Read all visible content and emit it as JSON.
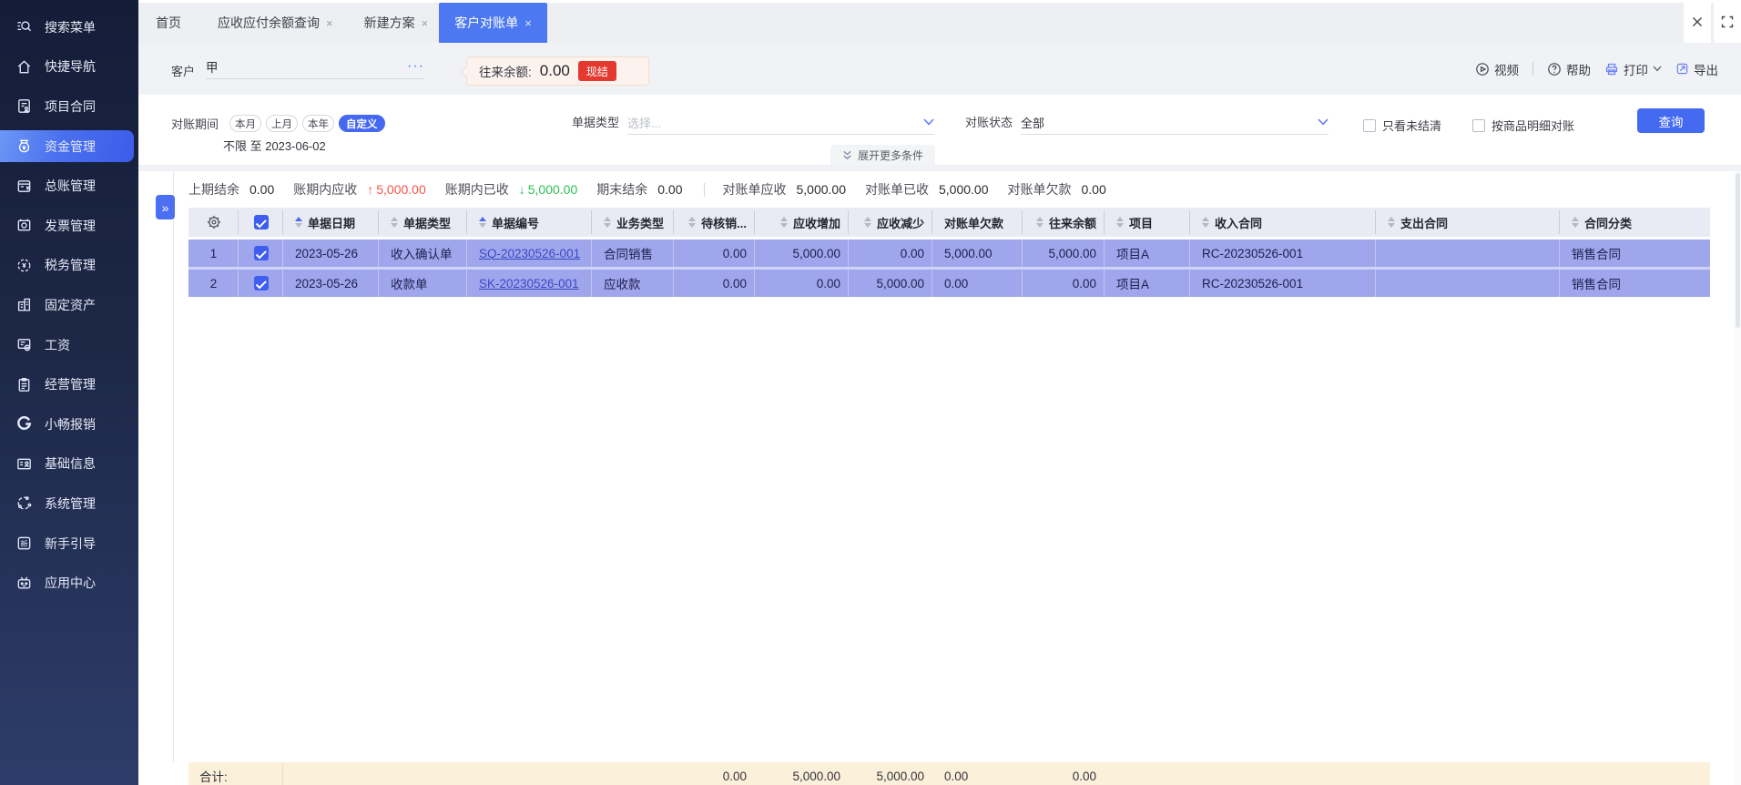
{
  "sidebar": {
    "items": [
      "搜索菜单",
      "快捷导航",
      "项目合同",
      "资金管理",
      "总账管理",
      "发票管理",
      "税务管理",
      "固定资产",
      "工资",
      "经营管理",
      "小畅报销",
      "基础信息",
      "系统管理",
      "新手引导",
      "应用中心"
    ],
    "active_item": "资金管理"
  },
  "tabs": {
    "home": "首页",
    "tab2": "应收应付余额查询",
    "tab3": "新建方案",
    "active": "客户对账单",
    "close_glyph": "×"
  },
  "window": {
    "close": "×"
  },
  "toolbar": {
    "customer_label": "客户",
    "customer_value": "甲",
    "more_glyph": "···",
    "balance_label": "往来余额:",
    "balance_value": "0.00",
    "settle_badge": "现结",
    "video": "视频",
    "help": "帮助",
    "print": "打印",
    "export": "导出"
  },
  "filters": {
    "period_label": "对账期间",
    "period_this_month": "本月",
    "period_last_month": "上月",
    "period_this_year": "本年",
    "period_custom": "自定义",
    "period_range": "不限 至 2023-06-02",
    "doc_type_label": "单据类型",
    "doc_type_placeholder": "选择...",
    "status_label": "对账状态",
    "status_value": "全部",
    "checkbox_unsettled": "只看未结清",
    "checkbox_by_product": "按商品明细对账",
    "search_button": "查询",
    "expand_more": "展开更多条件"
  },
  "summary": {
    "prev_balance_label": "上期结余",
    "prev_balance_value": "0.00",
    "ar_in_period_label": "账期内应收",
    "ar_in_period_value": "5,000.00",
    "received_in_period_label": "账期内已收",
    "received_in_period_value": "5,000.00",
    "end_balance_label": "期末结余",
    "end_balance_value": "0.00",
    "stmt_ar_label": "对账单应收",
    "stmt_ar_value": "5,000.00",
    "stmt_received_label": "对账单已收",
    "stmt_received_value": "5,000.00",
    "stmt_debt_label": "对账单欠款",
    "stmt_debt_value": "0.00",
    "up_arrow": "↑",
    "down_arrow": "↓"
  },
  "table": {
    "headers": [
      "单据日期",
      "单据类型",
      "单据编号",
      "业务类型",
      "待核销...",
      "应收增加",
      "应收减少",
      "对账单欠款",
      "往来余额",
      "项目",
      "收入合同",
      "支出合同",
      "合同分类"
    ],
    "rows": [
      {
        "seq": "1",
        "date": "2023-05-26",
        "doc_type": "收入确认单",
        "doc_no": "SQ-20230526-001",
        "biz_type": "合同销售",
        "pending": "0.00",
        "ar_increase": "5,000.00",
        "ar_decrease": "0.00",
        "statement_debt": "5,000.00",
        "balance": "5,000.00",
        "project": "项目A",
        "income_contract": "RC-20230526-001",
        "expense_contract": "",
        "contract_category": "销售合同"
      },
      {
        "seq": "2",
        "date": "2023-05-26",
        "doc_type": "收款单",
        "doc_no": "SK-20230526-001",
        "biz_type": "应收款",
        "pending": "0.00",
        "ar_increase": "0.00",
        "ar_decrease": "5,000.00",
        "statement_debt": "0.00",
        "balance": "0.00",
        "project": "项目A",
        "income_contract": "RC-20230526-001",
        "expense_contract": "",
        "contract_category": "销售合同"
      }
    ],
    "totals": {
      "label": "合计:",
      "pending": "0.00",
      "ar_increase": "5,000.00",
      "ar_decrease": "5,000.00",
      "statement_debt": "0.00",
      "balance": "0.00"
    },
    "expander_glyph": "»"
  }
}
